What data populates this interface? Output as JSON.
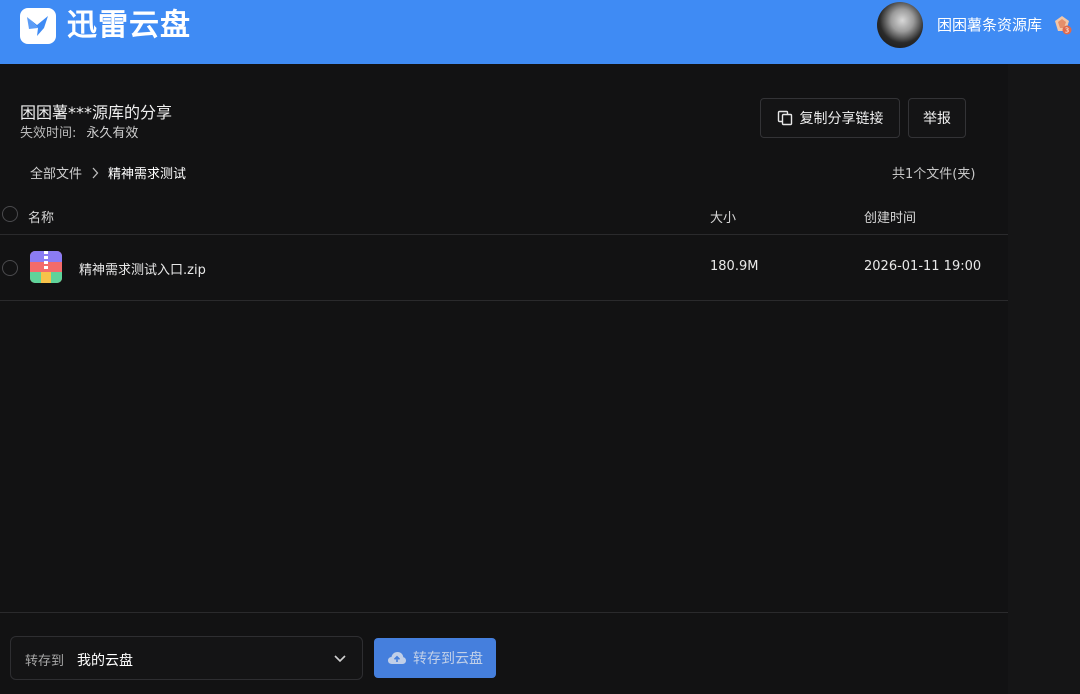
{
  "header": {
    "brand": "迅雷云盘",
    "user_name": "困困薯条资源库"
  },
  "share": {
    "title": "困困薯***源库的分享",
    "expire_label": "失效时间:",
    "expire_value": "永久有效",
    "copy_button": "复制分享链接",
    "report_button": "举报"
  },
  "breadcrumb": {
    "root": "全部文件",
    "current": "精神需求测试"
  },
  "file_count": "共1个文件(夹)",
  "table": {
    "columns": {
      "name": "名称",
      "size": "大小",
      "created": "创建时间"
    },
    "rows": [
      {
        "name": "精神需求测试入口.zip",
        "size": "180.9M",
        "created": "2026-01-11 19:00",
        "icon": "zip-archive-icon"
      }
    ]
  },
  "footer": {
    "save_to_label": "转存到",
    "save_to_value": "我的云盘",
    "save_button": "转存到云盘"
  },
  "colors": {
    "header_bg": "#3f8bf4",
    "page_bg": "#121213",
    "primary_button": "#4a89ef"
  }
}
